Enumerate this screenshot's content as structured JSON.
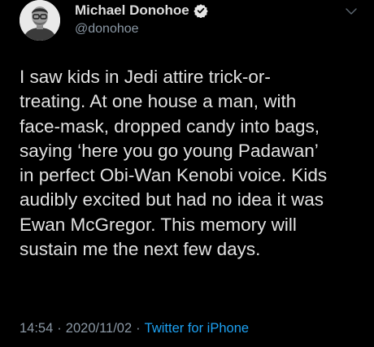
{
  "author": {
    "name": "Michael Donohoe",
    "handle": "@donohoe",
    "verified": true
  },
  "tweet": {
    "lines": [
      "I saw kids in Jedi attire trick-or-",
      "treating. At one house a man, with",
      "face-mask, dropped candy into bags,",
      "saying ‘here you go young Padawan’",
      "in perfect Obi-Wan Kenobi voice. Kids",
      "audibly excited but had no idea it was",
      "Ewan McGregor. This memory will",
      "sustain me the next few days."
    ],
    "time": "14:54",
    "date": "2020/11/02",
    "separator": "·",
    "source": "Twitter for iPhone"
  },
  "icons": {
    "verified": "verified-badge-icon",
    "menu": "chevron-down-icon"
  },
  "colors": {
    "background": "#000000",
    "text": "#e1e1e1",
    "secondary": "#8b98a5",
    "link": "#1da1f2"
  }
}
